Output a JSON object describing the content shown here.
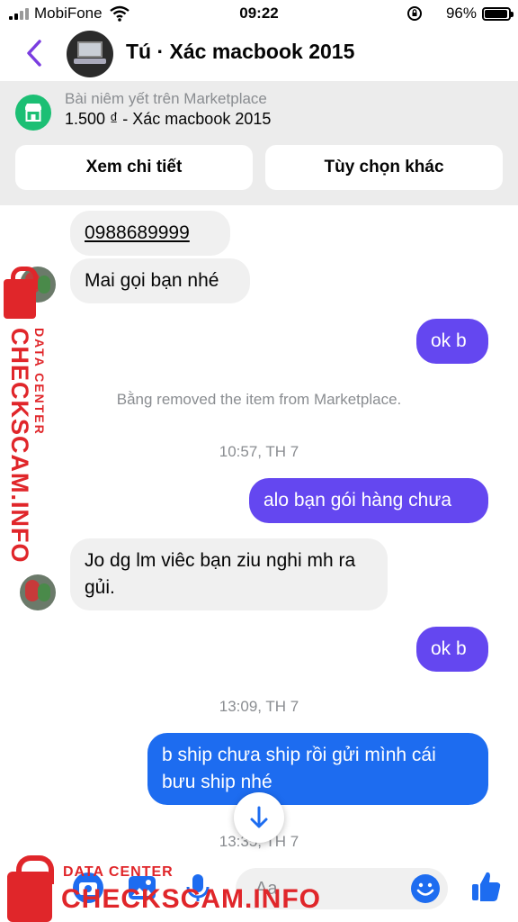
{
  "status_bar": {
    "carrier": "MobiFone",
    "time": "09:22",
    "battery": "96%",
    "battery_level": 0.96
  },
  "header": {
    "title": "Tú · Xác macbook 2015",
    "accent_color": "#7a3de0"
  },
  "listing": {
    "subtitle": "Bài niêm yết trên Marketplace",
    "price_title": "1.500 ₫ - Xác macbook 2015",
    "details_button": "Xem chi tiết",
    "options_button": "Tùy chọn khác"
  },
  "messages": {
    "m1": "0988689999",
    "m2": "Mai gọi bạn nhé",
    "m3": "ok b",
    "sys1": "Bằng removed the item from Marketplace.",
    "ts1": "10:57, TH 7",
    "m4": "alo bạn gói hàng chưa",
    "m5": "Jo dg lm viêc bạn ziu nghi mh ra gủi.",
    "m6": "ok b",
    "ts2": "13:09, TH 7",
    "m7": "b ship chưa ship rồi gửi mình cái bưu ship nhé",
    "ts3": "13:35, TH 7"
  },
  "composer": {
    "placeholder": "Aa"
  },
  "watermark": {
    "small": "DATA CENTER",
    "large": "CHECKSCAM.INFO"
  },
  "colors": {
    "outgoing_purple": "#6447f0",
    "outgoing_blue": "#1d6cf0",
    "incoming": "#f0f0f0",
    "marketplace_green": "#1cbf74",
    "watermark_red": "#e0262a"
  }
}
